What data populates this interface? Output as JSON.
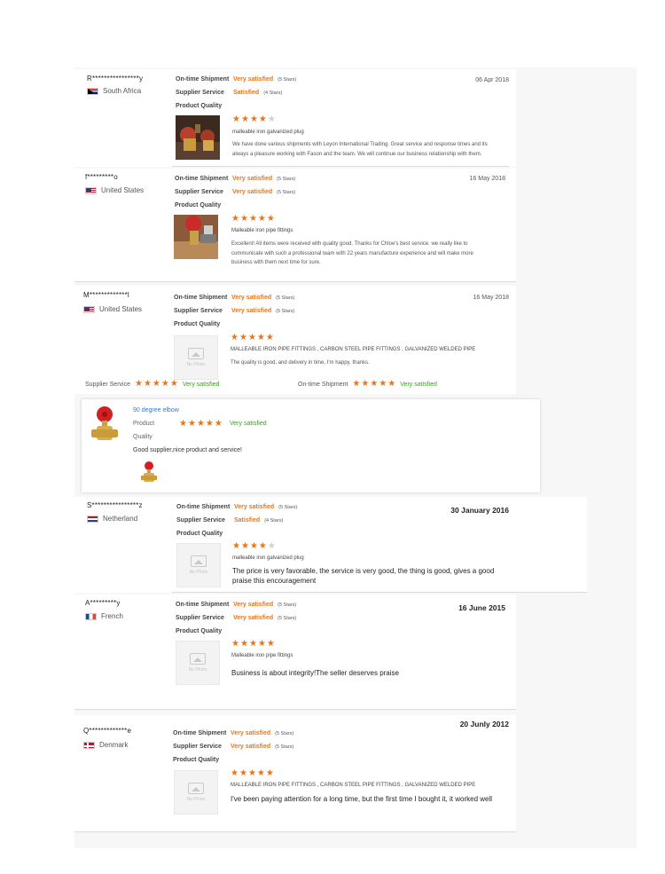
{
  "labels": {
    "on_time": "On-time Shipment",
    "supplier_service": "Supplier Service",
    "product_quality": "Product Quality",
    "no_photo": "No Photo"
  },
  "reviews": [
    {
      "buyer": "R****************y",
      "country": "South Africa",
      "flag": "za",
      "date": "06 Apr 2018",
      "on_time_value": "Very satisfied",
      "on_time_stars": "(5 Stars)",
      "service_value": "Satisfied",
      "service_stars": "(4 Stars)",
      "rating": 4,
      "product": "malleable iron galvanized plug",
      "comment": "We have done various shipments with Leyon International Trading. Great service and response times and its always a pleasure working with Fason and the team. We will continue our business relationship with them."
    },
    {
      "buyer": "f*********o",
      "country": "United States",
      "flag": "us",
      "date": "16 May 2018",
      "on_time_value": "Very satisfied",
      "on_time_stars": "(5 Stars)",
      "service_value": "Very satisfied",
      "service_stars": "(5 Stars)",
      "rating": 5,
      "product": "Malleable iron pipe fittings",
      "comment": "Excellent! All items were received with quality good. Thanks for Chloe's best service. we really like to communicate with such a professional team with 22 years manufacture experience and will make more business with them next time for sure."
    },
    {
      "buyer": "M*************l",
      "country": "United States",
      "flag": "us",
      "date": "16 May 2018",
      "on_time_value": "Very satisfied",
      "on_time_stars": "(5 Stars)",
      "service_value": "Very satisfied",
      "service_stars": "(5 Stars)",
      "rating": 5,
      "product": "MALLEABLE IRON PIPE FITTINGS , CARBON STEEL PIPE FITTINGS , GALVANIZED WELDED PIPE",
      "comment": "The quality is good, and delivery in time, I'm happy, thanks."
    },
    {
      "buyer": "S****************z",
      "country": "Netherland",
      "flag": "nl",
      "date": "30 January 2016",
      "on_time_value": "Very satisfied",
      "on_time_stars": "(5 Stars)",
      "service_value": "Satisfied",
      "service_stars": "(4 Stars)",
      "rating": 4,
      "product": "malleable iron galvanized plug",
      "comment": "The price is very favorable, the service is very good, the thing is good, gives a good praise this encouragement"
    },
    {
      "buyer": "A*********y",
      "country": "French",
      "flag": "fr",
      "date": "16 June 2015",
      "on_time_value": "Very satisfied",
      "on_time_stars": "(5 Stars)",
      "service_value": "Very satisfied",
      "service_stars": "(5 Stars)",
      "rating": 5,
      "product": "Malleable iron pipe fittings",
      "comment": "Business is about integrity!The seller deserves praise"
    },
    {
      "buyer": "Q*************e",
      "country": "Denmark",
      "flag": "dk",
      "date": "20 Junly 2012",
      "on_time_value": "Very satisfied",
      "on_time_stars": "(5 Stars)",
      "service_value": "Very satisfied",
      "service_stars": "(5 Stars)",
      "rating": 5,
      "product": "MALLEABLE IRON PIPE FITTINGS , CARBON STEEL PIPE FITTINGS , GALVANIZED WELDED PIPE",
      "comment": "I've been paying attention for a long time, but the first time I bought it, it worked well"
    }
  ],
  "summary_strip": {
    "supplier_label": "Supplier Service",
    "supplier_value": "Very satisfied",
    "supplier_rating": 5,
    "shipment_label": "On-time Shipment",
    "shipment_value": "Very satisfied",
    "shipment_rating": 5
  },
  "product_card": {
    "title": "90 degree elbow",
    "product_label": "Product",
    "quality_label": "Quality",
    "value": "Very satisfied",
    "rating": 5,
    "comment": "Good supplier,nice product and service!"
  },
  "colors": {
    "accent": "#e8751a",
    "positive": "#3a9d23",
    "link": "#3b78c2"
  }
}
